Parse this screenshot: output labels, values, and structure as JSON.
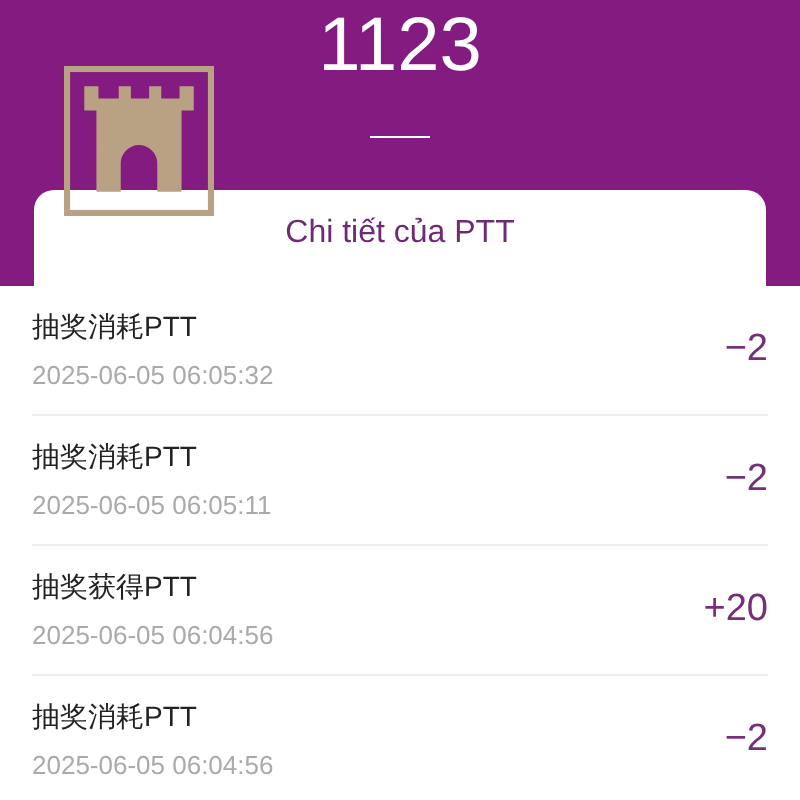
{
  "header": {
    "balance": "1123"
  },
  "card": {
    "title": "Chi tiết của PTT"
  },
  "records": [
    {
      "title": "抽奖消耗PTT",
      "time": "2025-06-05 06:05:32",
      "amount": "−2"
    },
    {
      "title": "抽奖消耗PTT",
      "time": "2025-06-05 06:05:11",
      "amount": "−2"
    },
    {
      "title": "抽奖获得PTT",
      "time": "2025-06-05 06:04:56",
      "amount": "+20"
    },
    {
      "title": "抽奖消耗PTT",
      "time": "2025-06-05 06:04:56",
      "amount": "−2"
    }
  ]
}
